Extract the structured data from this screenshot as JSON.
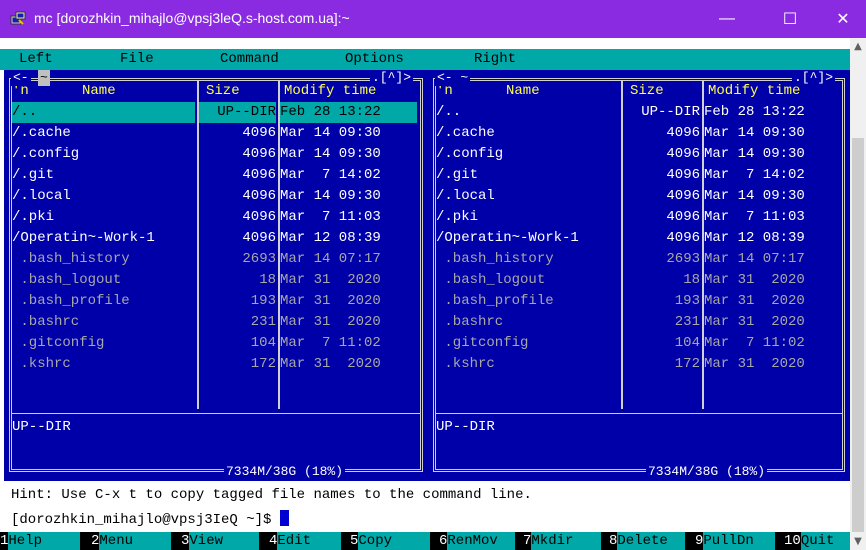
{
  "window": {
    "title": "mc [dorozhkin_mihajlo@vpsj3leQ.s-host.com.ua]:~",
    "minimize": "—",
    "maximize": "☐",
    "close": "✕"
  },
  "menu": [
    "Left",
    "File",
    "Command",
    "Options",
    "Right"
  ],
  "left_panel": {
    "top_left": "<-",
    "path": "~",
    "top_right": ".[^]>",
    "columns": {
      "n": "'n",
      "name": "Name",
      "size": "Size",
      "mtime": "Modify time"
    },
    "rows": [
      {
        "name": "/..",
        "size": "UP--DIR",
        "date": "Feb 28 13:22",
        "kind": "dir"
      },
      {
        "name": "/.cache",
        "size": "4096",
        "date": "Mar 14 09:30",
        "kind": "dir"
      },
      {
        "name": "/.config",
        "size": "4096",
        "date": "Mar 14 09:30",
        "kind": "dir"
      },
      {
        "name": "/.git",
        "size": "4096",
        "date": "Mar  7 14:02",
        "kind": "dir"
      },
      {
        "name": "/.local",
        "size": "4096",
        "date": "Mar 14 09:30",
        "kind": "dir"
      },
      {
        "name": "/.pki",
        "size": "4096",
        "date": "Mar  7 11:03",
        "kind": "dir"
      },
      {
        "name": "/Operatin~-Work-1",
        "size": "4096",
        "date": "Mar 12 08:39",
        "kind": "dir"
      },
      {
        "name": " .bash_history",
        "size": "2693",
        "date": "Mar 14 07:17",
        "kind": "file"
      },
      {
        "name": " .bash_logout",
        "size": "18",
        "date": "Mar 31  2020",
        "kind": "file"
      },
      {
        "name": " .bash_profile",
        "size": "193",
        "date": "Mar 31  2020",
        "kind": "file"
      },
      {
        "name": " .bashrc",
        "size": "231",
        "date": "Mar 31  2020",
        "kind": "file"
      },
      {
        "name": " .gitconfig",
        "size": "104",
        "date": "Mar  7 11:02",
        "kind": "file"
      },
      {
        "name": " .kshrc",
        "size": "172",
        "date": "Mar 31  2020",
        "kind": "file"
      }
    ],
    "status": "UP--DIR",
    "disk": "7334M/38G (18%)"
  },
  "right_panel": {
    "top_left": "<- ~",
    "top_right": ".[^]>",
    "columns": {
      "n": "'n",
      "name": "Name",
      "size": "Size",
      "mtime": "Modify time"
    },
    "rows": [
      {
        "name": "/..",
        "size": "UP--DIR",
        "date": "Feb 28 13:22",
        "kind": "dir"
      },
      {
        "name": "/.cache",
        "size": "4096",
        "date": "Mar 14 09:30",
        "kind": "dir"
      },
      {
        "name": "/.config",
        "size": "4096",
        "date": "Mar 14 09:30",
        "kind": "dir"
      },
      {
        "name": "/.git",
        "size": "4096",
        "date": "Mar  7 14:02",
        "kind": "dir"
      },
      {
        "name": "/.local",
        "size": "4096",
        "date": "Mar 14 09:30",
        "kind": "dir"
      },
      {
        "name": "/.pki",
        "size": "4096",
        "date": "Mar  7 11:03",
        "kind": "dir"
      },
      {
        "name": "/Operatin~-Work-1",
        "size": "4096",
        "date": "Mar 12 08:39",
        "kind": "dir"
      },
      {
        "name": " .bash_history",
        "size": "2693",
        "date": "Mar 14 07:17",
        "kind": "file"
      },
      {
        "name": " .bash_logout",
        "size": "18",
        "date": "Mar 31  2020",
        "kind": "file"
      },
      {
        "name": " .bash_profile",
        "size": "193",
        "date": "Mar 31  2020",
        "kind": "file"
      },
      {
        "name": " .bashrc",
        "size": "231",
        "date": "Mar 31  2020",
        "kind": "file"
      },
      {
        "name": " .gitconfig",
        "size": "104",
        "date": "Mar  7 11:02",
        "kind": "file"
      },
      {
        "name": " .kshrc",
        "size": "172",
        "date": "Mar 31  2020",
        "kind": "file"
      }
    ],
    "status": "UP--DIR",
    "disk": "7334M/38G (18%)"
  },
  "hint": "Hint: Use C-x t to copy tagged file names to the command line.",
  "prompt": "[dorozhkin_mihajlo@vpsj3IeQ ~]$ ",
  "fkeys": [
    {
      "num": "1",
      "label": "Help"
    },
    {
      "num": "2",
      "label": "Menu"
    },
    {
      "num": "3",
      "label": "View"
    },
    {
      "num": "4",
      "label": "Edit"
    },
    {
      "num": "5",
      "label": "Copy"
    },
    {
      "num": "6",
      "label": "RenMov"
    },
    {
      "num": "7",
      "label": "Mkdir"
    },
    {
      "num": "8",
      "label": "Delete"
    },
    {
      "num": "9",
      "label": "PullDn"
    },
    {
      "num": "10",
      "label": "Quit"
    }
  ],
  "colors": {
    "titlebar": "#8a2be2",
    "panel_bg": "#0000a8",
    "menu_bg": "#00a8a8",
    "header_fg": "#ffff54",
    "file_fg": "#a8a8a8"
  },
  "icons": {
    "app": "putty-icon",
    "scroll_up": "chevron-up-icon",
    "scroll_down": "chevron-down-icon"
  }
}
